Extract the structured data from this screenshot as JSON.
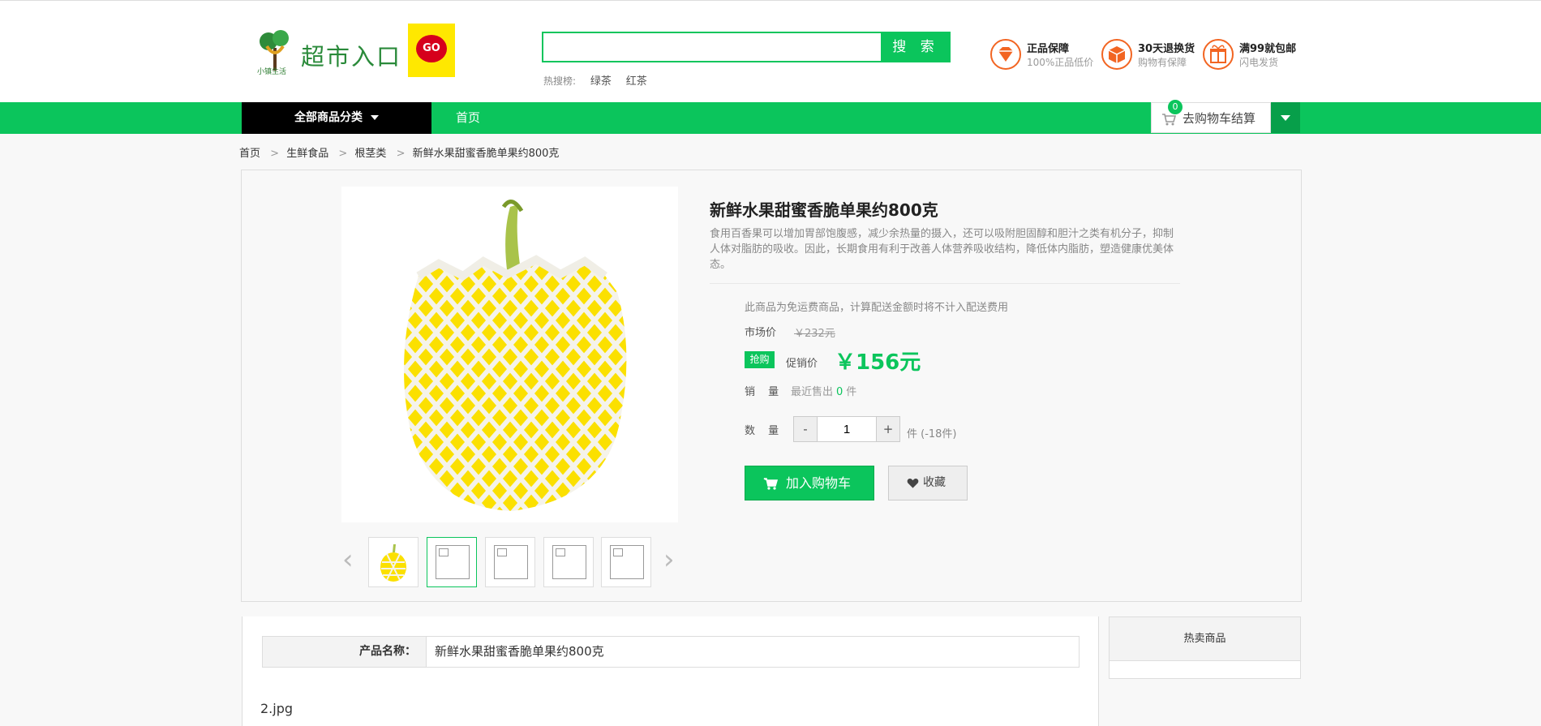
{
  "header": {
    "logo_text": "超市入口",
    "logo_small": "小镇生活",
    "logo_go": "GO",
    "search_placeholder": "",
    "search_button": "搜 索",
    "hot_label": "热搜榜:",
    "hot_items": [
      "绿茶",
      "红茶"
    ],
    "guarantees": [
      {
        "title": "正品保障",
        "subtitle": "100%正品低价",
        "icon": "diamond-icon"
      },
      {
        "title": "30天退换货",
        "subtitle": "购物有保障",
        "icon": "box-icon"
      },
      {
        "title": "满99就包邮",
        "subtitle": "闪电发货",
        "icon": "gift-icon"
      }
    ]
  },
  "nav": {
    "all_categories": "全部商品分类",
    "home": "首页",
    "cart_label": "去购物车结算",
    "cart_count": "0"
  },
  "breadcrumb": [
    "首页",
    "生鲜食品",
    "根茎类",
    "新鲜水果甜蜜香脆单果约800克"
  ],
  "product": {
    "title": "新鲜水果甜蜜香脆单果约800克",
    "description": "食用百香果可以增加胃部饱腹感，减少余热量的摄入，还可以吸附胆固醇和胆汁之类有机分子，抑制人体对脂肪的吸收。因此，长期食用有利于改善人体营养吸收结构，降低体内脂肪，塑造健康优美体态。",
    "freight_note": "此商品为免运费商品，计算配送金额时将不计入配送费用",
    "market_price_label": "市场价",
    "market_price": "￥232元",
    "sale_badge": "抢购",
    "sale_price_label": "促销价",
    "sale_price": "￥156元",
    "sales_label": "销 量",
    "sales_prefix": "最近售出",
    "sales_count": "0",
    "sales_suffix": "件",
    "qty_label": "数 量",
    "qty_minus": "-",
    "qty_value": "1",
    "qty_plus": "+",
    "qty_unit": "件 (-18件)",
    "add_cart": "加入购物车",
    "favorite": "收藏",
    "thumb_prev": "‹",
    "thumb_next": "›"
  },
  "detail": {
    "spec_key": "产品名称：",
    "spec_value": "新鲜水果甜蜜香脆单果约800克",
    "image_alt": "2.jpg"
  },
  "sidebar": {
    "hot_title": "热卖商品"
  },
  "colors": {
    "accent": "#0bc55c",
    "nav_black": "#000000",
    "guarantee_orange": "#f26522"
  }
}
